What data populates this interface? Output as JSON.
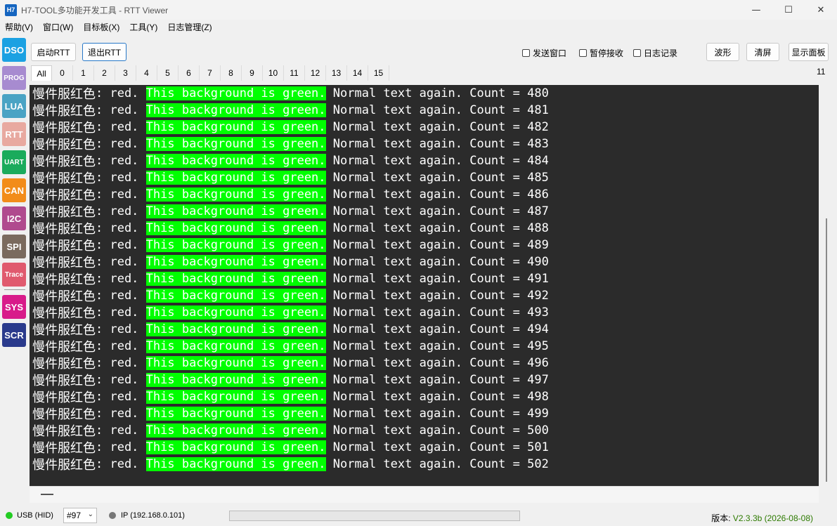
{
  "window": {
    "icon_text": "H7",
    "title": "H7-TOOL多功能开发工具 - RTT Viewer",
    "minimize": "—",
    "maximize": "☐",
    "close": "✕"
  },
  "menu": [
    "帮助(V)",
    "窗口(W)",
    "目标板(X)",
    "工具(Y)",
    "日志管理(Z)"
  ],
  "sidebar": {
    "tools": [
      {
        "label": "DSO",
        "color": "#1ba1e2"
      },
      {
        "label": "PROG",
        "color": "#a78bd0"
      },
      {
        "label": "LUA",
        "color": "#4aa3c4"
      },
      {
        "label": "RTT",
        "color": "#e8a9a0"
      },
      {
        "label": "UART",
        "color": "#1aab5c"
      },
      {
        "label": "CAN",
        "color": "#f28c1a"
      },
      {
        "label": "I2C",
        "color": "#b04a8e"
      },
      {
        "label": "SPI",
        "color": "#7a6a5e"
      },
      {
        "label": "Trace",
        "color": "#e05a6e"
      },
      {
        "label": "SYS",
        "color": "#d81b8a"
      },
      {
        "label": "SCR",
        "color": "#2a3a8c"
      }
    ]
  },
  "toolbar": {
    "start_label": "启动RTT",
    "stop_label": "退出RTT",
    "send_window_label": "发送窗口",
    "pause_label": "暂停接收",
    "log_label": "日志记录",
    "wave_label": "波形",
    "clear_label": "清屏",
    "panel_label": "显示面板"
  },
  "tabs": {
    "labels": [
      "All",
      "0",
      "1",
      "2",
      "3",
      "4",
      "5",
      "6",
      "7",
      "8",
      "9",
      "10",
      "11",
      "12",
      "13",
      "14",
      "15"
    ],
    "active": "All",
    "count": "11"
  },
  "terminal": {
    "prefix": "慢件服红色",
    "red_part": ": red. ",
    "green_part": "This background is green.",
    "normal_part": " Normal text again. Count = ",
    "counts": [
      480,
      481,
      482,
      483,
      484,
      485,
      486,
      487,
      488,
      489,
      490,
      491,
      492,
      493,
      494,
      495,
      496,
      497,
      498,
      499,
      500,
      501,
      502
    ],
    "green_color": "#00ff00"
  },
  "status": {
    "usb_label": "USB (HID)",
    "usb_color": "#22cc22",
    "device": "#97",
    "ip_label": "IP (192.168.0.101)",
    "ip_color": "#777777",
    "version_label": "版本: ",
    "version_value": "V2.3.3b (2026-08-08)"
  }
}
